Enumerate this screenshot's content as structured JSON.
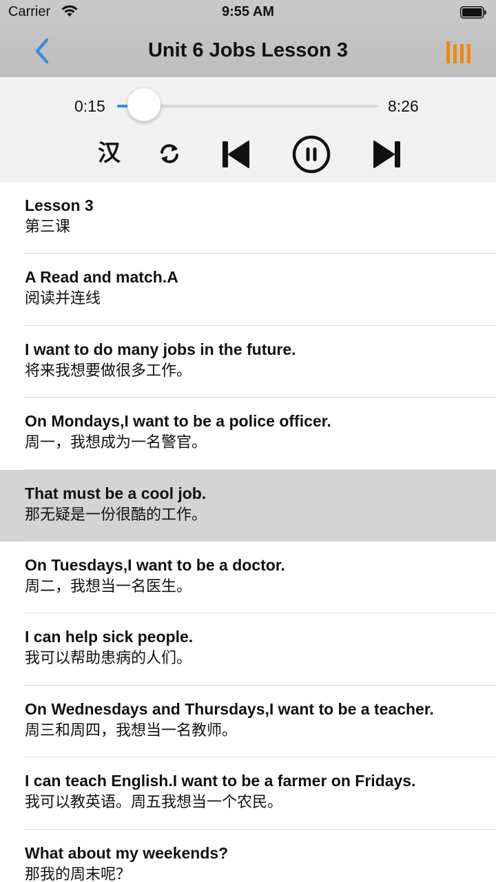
{
  "status_bar": {
    "carrier": "Carrier",
    "time": "9:55 AM"
  },
  "nav": {
    "title": "Unit 6 Jobs Lesson 3",
    "accent_color": "#f0880e",
    "back_color": "#3a8de0"
  },
  "player": {
    "current_time": "0:15",
    "duration": "8:26",
    "progress": 0.03,
    "translate_label": "汉"
  },
  "sentences": [
    {
      "en": "Lesson 3",
      "zh": "第三课"
    },
    {
      "en": "A Read and match.A",
      "zh": "阅读并连线"
    },
    {
      "en": "I want to do many jobs in the future.",
      "zh": "将来我想要做很多工作。"
    },
    {
      "en": "On Mondays,I want to be a police officer.",
      "zh": "周一，我想成为一名警官。"
    },
    {
      "en": "That must be a cool job.",
      "zh": "那无疑是一份很酷的工作。",
      "active": true
    },
    {
      "en": "On Tuesdays,I want to be a doctor.",
      "zh": "周二，我想当一名医生。"
    },
    {
      "en": "I can help sick people.",
      "zh": "我可以帮助患病的人们。"
    },
    {
      "en": "On Wednesdays and Thursdays,I want to be a teacher.",
      "zh": "周三和周四，我想当一名教师。"
    },
    {
      "en": "I can teach English.I want to be a farmer on Fridays.",
      "zh": "我可以教英语。周五我想当一个农民。"
    },
    {
      "en": "What about my weekends?",
      "zh": "那我的周末呢？"
    }
  ]
}
